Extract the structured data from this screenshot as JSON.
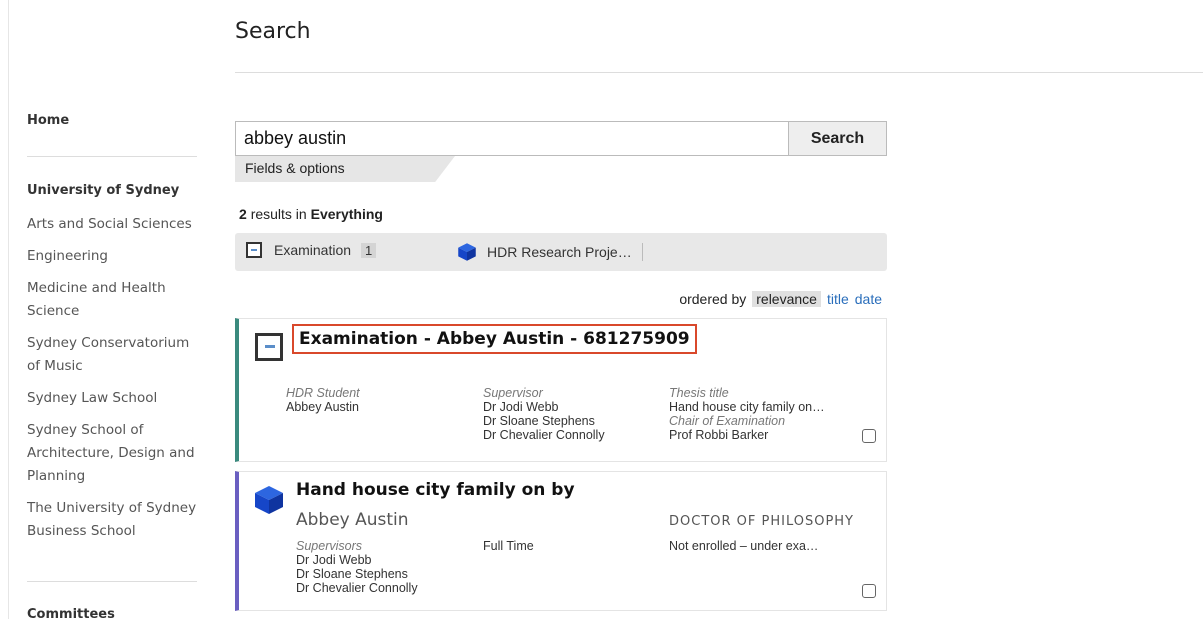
{
  "page": {
    "title": "Search"
  },
  "sidebar": {
    "home": "Home",
    "group": "University of Sydney",
    "items": [
      "Arts and Social Sciences",
      "Engineering",
      "Medicine and Health Science",
      "Sydney Conservatorium of Music",
      "Sydney Law School",
      "Sydney School of Architecture, Design and Planning",
      "The University of Sydney Business School"
    ],
    "committees": "Committees"
  },
  "search": {
    "query": "abbey austin",
    "button_label": "Search",
    "fields_options": "Fields & options"
  },
  "results": {
    "count": "2",
    "in_text": "results in",
    "scope": "Everything",
    "facets": [
      {
        "label": "Examination",
        "count": "1",
        "icon": "examination-icon"
      },
      {
        "label": "HDR Research Proje…",
        "icon": "cube-icon"
      }
    ],
    "ordering": {
      "prefix": "ordered by",
      "active": "relevance",
      "options": [
        "title",
        "date"
      ]
    },
    "cards": [
      {
        "title": "Examination - Abbey Austin - 681275909",
        "accent": "#3a8a7e",
        "student_label": "HDR Student",
        "student": "Abbey Austin",
        "supervisor_label": "Supervisor",
        "supervisors": [
          "Dr Jodi Webb",
          "Dr Sloane Stephens",
          "Dr Chevalier Connolly"
        ],
        "thesis_label": "Thesis title",
        "thesis": "Hand house city family on…",
        "chair_label": "Chair of Examination",
        "chair": "Prof Robbi Barker"
      },
      {
        "title": "Hand house city family on by",
        "accent": "#6a5fc1",
        "subtitle": "Abbey Austin",
        "degree": "DOCTOR OF PHILOSOPHY",
        "supervisors_label": "Supervisors",
        "supervisors": [
          "Dr Jodi Webb",
          "Dr Sloane Stephens",
          "Dr Chevalier Connolly"
        ],
        "attendance": "Full Time",
        "status": "Not enrolled – under exa…"
      }
    ]
  },
  "colors": {
    "link": "#2a6ebb",
    "cube": "#1646c8",
    "highlight_border": "#d9482b"
  }
}
